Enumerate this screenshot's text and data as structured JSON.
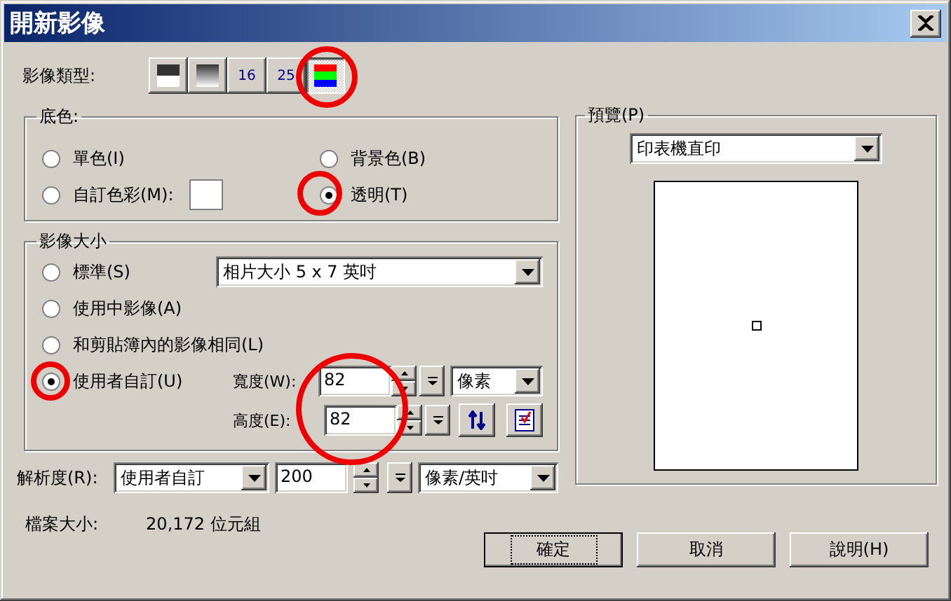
{
  "window": {
    "title": "開新影像"
  },
  "image_type": {
    "label": "影像類型:",
    "options": [
      {
        "kind": "mono",
        "selected": false
      },
      {
        "kind": "gray",
        "selected": false
      },
      {
        "kind": "text",
        "label": "16",
        "selected": false
      },
      {
        "kind": "text",
        "label": "25",
        "selected": false
      },
      {
        "kind": "rgb",
        "selected": true
      }
    ]
  },
  "background": {
    "title": "底色:",
    "options": [
      {
        "kind": "plain",
        "label": "單色(I)",
        "selected": false
      },
      {
        "kind": "plain",
        "label": "背景色(B)",
        "selected": false
      },
      {
        "kind": "custom",
        "label": "自訂色彩(M):",
        "selected": false
      },
      {
        "kind": "plain",
        "label": "透明(T)",
        "selected": true
      }
    ]
  },
  "image_size": {
    "title": "影像大小",
    "preset": "相片大小 5 x 7  英吋",
    "options": [
      {
        "label": "標準(S)",
        "selected": false
      },
      {
        "label": "使用中影像(A)",
        "selected": false
      },
      {
        "label": "和剪貼簿內的影像相同(L)",
        "selected": false
      },
      {
        "label": "使用者自訂(U)",
        "selected": true
      }
    ],
    "width": {
      "label": "寬度(W):",
      "value": "82"
    },
    "height": {
      "label": "高度(E):",
      "value": "82"
    },
    "unit": "像素"
  },
  "resolution": {
    "label": "解析度(R):",
    "mode": "使用者自訂",
    "value": "200",
    "unit": "像素/英吋"
  },
  "file_size": {
    "label": "檔案大小:",
    "value": "20,172 位元組"
  },
  "preview": {
    "title": "預覽(P)",
    "mode": "印表機直印"
  },
  "buttons": [
    {
      "label": "確定",
      "default": true
    },
    {
      "label": "取消",
      "default": false
    },
    {
      "label": "說明(H)",
      "default": false
    }
  ]
}
